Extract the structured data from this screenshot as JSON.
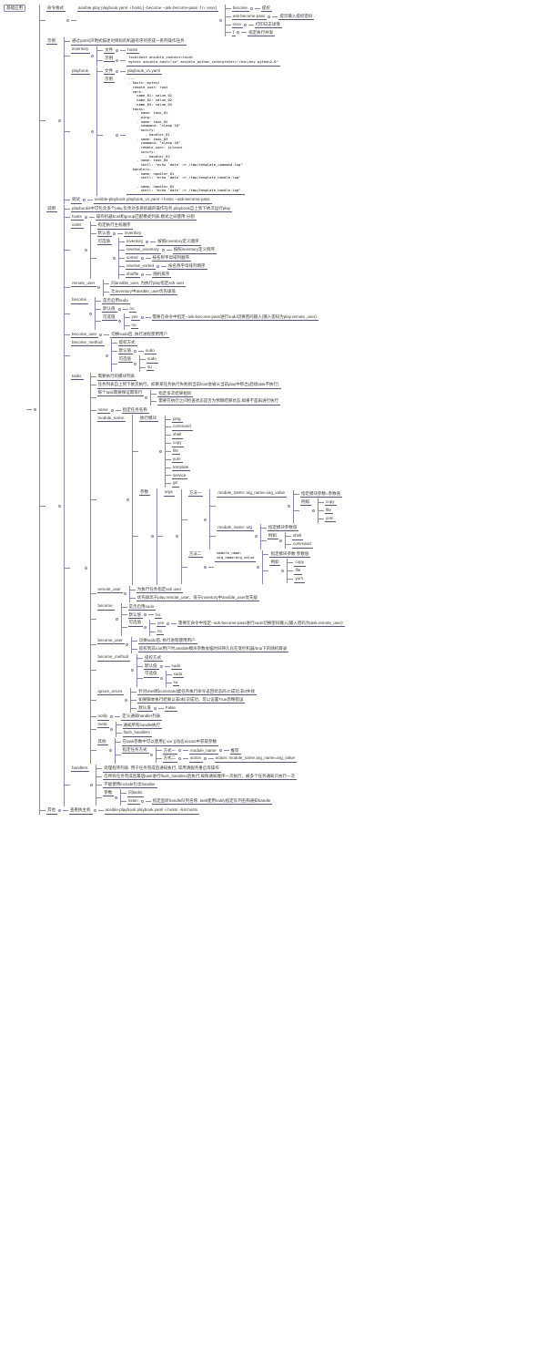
{
  "root": "基础应用",
  "cmd": {
    "label": "命令格式",
    "value": "ansible-play playbook.yaml -i hosts [--become --ask-become-pass -f n -vvvv]",
    "opts": [
      {
        "k": "become",
        "v": "提权"
      },
      {
        "k": "ask-become-pass",
        "v": "提示输入提权密码"
      },
      {
        "k": "vvvv",
        "v": "打印日志详情"
      },
      {
        "k": "f",
        "v": "指定执行并发"
      }
    ]
  },
  "yaml_intro": "通过yaml(声明式描述对目标的机器有序的完成一系列操作任务",
  "example": {
    "label": "示例",
    "inventory": {
      "label": "inventory",
      "file": {
        "k": "文件",
        "v": "hosts"
      },
      "sample": {
        "k": "示例",
        "v": "localhost ansible_connect=local\nmytest ansible_host=\"ip\" ansible_python_interpreter=\"/bin/env python2.6\""
      }
    },
    "playbook": {
      "label": "playbook",
      "file": {
        "k": "文件",
        "v": "playbook_v1.yaml"
      },
      "sample_k": "示例",
      "sample": "---\n- hosts: mytest\n  remote_user: root\n  vars:\n    name_01: value_01\n    name_02: value_02\n    name_03: value_03\n  tasks:\n    - name: task_01\n      ping:\n    - name: task_02\n      command: \"sleep 10\"\n      notify:\n        - handler_01\n    - name: task_03\n      command: \"sleep 10\"\n      remote_user: silence\n      notify:\n        - handler_02\n    - name: task_04\n      shell: \"echo `date` >> /tmp/template_command.log\"\n  handlers:\n    - name: handler_01\n      shell: \"echo `date` >> /tmp/template_handle.log\"\n\n    - name: handler_02\n      shell: \"echo `date` >> /tmp/template_handle.log\""
    },
    "test": {
      "k": "调试",
      "v": "ansible-playbook playbook_v1.yaml -i hosts --ask-become-pass"
    }
  },
  "explain": {
    "label": "说明",
    "pb_intro": "playbooks中可包含多个play,负责对多族机器的操作任务,playbook自上到下依次运行play",
    "hosts": {
      "k": "hosts",
      "v": "操作机器host和group匹配模式列表,模式之间使用:分割"
    },
    "order": {
      "k": "order",
      "intro": "指定执行主机顺序",
      "default": {
        "k": "默认值",
        "v": "inventory"
      },
      "opts_k": "可选值",
      "opts": [
        {
          "k": "inventory",
          "v": "按照inventory定义顺序"
        },
        {
          "k": "reverse_inventory",
          "v": "按照inventory定义倒序"
        },
        {
          "k": "sorted",
          "v": "按名称字母排列顺序"
        },
        {
          "k": "reverse_sorted",
          "v": "按名称字母排列倒序"
        },
        {
          "k": "shuffle",
          "v": "随机排序"
        }
      ]
    },
    "remote_user": {
      "k": "remote_user",
      "l1": "同ansible_user, 为执行play指定ssh user",
      "l2": "比inventory中ansible_user优先级低"
    },
    "become": {
      "k": "become",
      "intro": "是否启用sudo",
      "default": {
        "k": "默认值",
        "v": "no"
      },
      "opts_k": "可选值",
      "yes": "yes",
      "yes_note": "需要在命令中指定--ask-become-pass进行sudo切换密码输入(输入密码为play.remote_user)",
      "no": "no"
    },
    "become_user": {
      "k": "become_user",
      "v": "切换sudo后, 执行进程使用用户"
    },
    "become_method": {
      "k": "become_method",
      "intro": "提权方式",
      "default": {
        "k": "默认值",
        "v": "sudo"
      },
      "opts_k": "可选值",
      "opts": [
        "sudo",
        "su"
      ]
    },
    "tasks": {
      "k": "tasks",
      "intro": "需要执行的模块列表",
      "seq": "任务列表自上到下依次执行，如果某任务执行失败则当前host会被从当前play中移出(后续task不执行)",
      "idem_k": "每个task需要保证幂等行",
      "idem": [
        "指定多次结果相同",
        "需要在执行之间检查状态是否为预期结果状态,如果不是再进行执行"
      ],
      "name": {
        "k": "name",
        "v": "指定任务名称"
      },
      "exec_k": "执行模块",
      "exec": [
        "ping",
        "command",
        "shell",
        "copy",
        "file",
        "yum",
        "template",
        "service",
        "git"
      ],
      "module_name": "module_name",
      "args": {
        "k": "参数",
        "argsk": "args",
        "spec": {
          "k": "指定模块参数=参数值",
          "sub_k": "例如",
          "sub": [
            "copy",
            "file",
            "yum"
          ]
        },
        "m1": {
          "k": "方法一",
          "a": {
            "k": "module_name: arg_name=arg_value"
          },
          "b": {
            "k": "module_name: arg",
            "s": "指定模块参数值",
            "sub_k": "例如",
            "sub": [
              "shell",
              "command"
            ]
          }
        },
        "m2": {
          "k": "方法二",
          "a": "module_name:\narg_name:arg_value",
          "s": "指定模块参数:参数值",
          "sub_k": "例如",
          "sub": [
            "copy",
            "file",
            "yum"
          ]
        }
      },
      "t_remote_user": {
        "k": "remote_user",
        "l1": "为执行任务指定ssh user",
        "l2": "优先级高于play.remote_user，低于inventory中ansible_user优先级"
      },
      "t_become": {
        "k": "become",
        "intro": "是否启用sudo",
        "default": {
          "k": "默认值",
          "v": "no"
        },
        "opts_k": "可选值",
        "yes": "yes",
        "yes_note": "需要在命令中指定--ask-become-pass进行sudo切换密码输入(输入密码为task.remote_user)",
        "no": "no"
      },
      "t_become_user": {
        "k": "become_user",
        "l1": "切换sudo后, 执行进程使用用户",
        "l2": "提权到非root用户时,ansible模块参数会临时间持久化在受控机器/tmp下的随机目录"
      },
      "t_become_method": {
        "k": "become_method",
        "intro": "提权方式",
        "default": {
          "k": "默认值",
          "v": "sudo"
        },
        "opts_k": "可选值",
        "opts": [
          "sudo",
          "su"
        ]
      },
      "ignore_errors": {
        "k": "ignore_errors",
        "l1": "针对shell和command类任务执行命令返回状态码,0:成功,非0失败",
        "l2": "如果脚本执行结果以非0标识成功，可以设置True忽略错误",
        "default": {
          "k": "默认值",
          "v": "False"
        }
      },
      "notify": {
        "k": "notify",
        "v": "定义通知handler列表"
      },
      "meta": {
        "k": "meta",
        "l1": "通知所有handle执行",
        "l2": "flush_handlers"
      },
      "other": {
        "k": "其他",
        "l1": "在task参数中可以使用{{ var }}动态从vars中获取参数",
        "tt": {
          "k": "指定任务方式",
          "m1": {
            "k": "方式一",
            "a": "module_name",
            "b": "推荐"
          },
          "m2": {
            "k": "方式二",
            "a": "action",
            "b": "action: module_name arg_name=arg_value"
          }
        }
      }
    },
    "handlers": {
      "k": "handlers",
      "l1": "处理程序列表, 用于任务完成后通知执行, 常用清服务重启等操作",
      "l2": "在所有任务完成后最后task进行flush_handlers后执行,按照通知顺序一次执行，被多个任务通知只执行一次",
      "l3": "不能使用include包含handler",
      "params": {
        "k": "参数",
        "tasks": "同tasks",
        "listen": {
          "k": "listen",
          "v": "指定监听handle队列名称, task使用notify指定队列名称通知handle"
        }
      }
    }
  },
  "other": {
    "k": "其他",
    "sub": {
      "k": "查看执主机",
      "v": "ansible-playbook playbook.yaml -i hosts --list-hosts"
    }
  }
}
